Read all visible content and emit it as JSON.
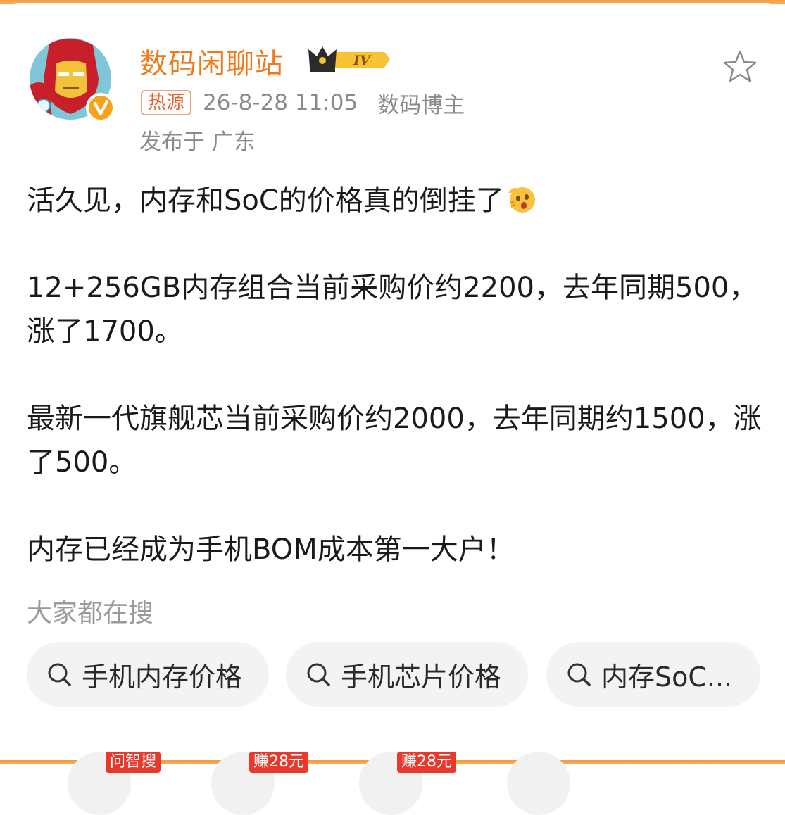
{
  "post": {
    "author_name": "数码闲聊站",
    "level_badge": "IV",
    "source_tag": "热源",
    "timestamp": "26-8-28 11:05",
    "author_role": "数码博主",
    "location": "发布于 广东",
    "paragraphs": [
      "活久见，内存和SoC的价格真的倒挂了",
      "12+256GB内存组合当前采购价约2200，去年同期500，涨了1700。",
      "最新一代旗舰芯当前采购价约2000，去年同期约1500，涨了500。",
      "内存已经成为手机BOM成本第一大户！"
    ],
    "emoji": "shocked-face-emoji"
  },
  "search": {
    "heading": "大家都在搜",
    "chips": [
      "手机内存价格",
      "手机芯片价格",
      "内存SoC..."
    ]
  },
  "bottom_tags": [
    "问智搜",
    "赚28元",
    "赚28元"
  ],
  "colors": {
    "accent": "#f07a1a",
    "tag_border": "#f0a37a",
    "tag_text": "#e5622e",
    "muted": "#8a8a8a",
    "chip_bg": "#f3f3f3",
    "promo_red": "#e8392c"
  },
  "icons": [
    "avatar-ironman",
    "verified-v-icon",
    "crown-icon",
    "star-outline-icon",
    "search-icon"
  ]
}
